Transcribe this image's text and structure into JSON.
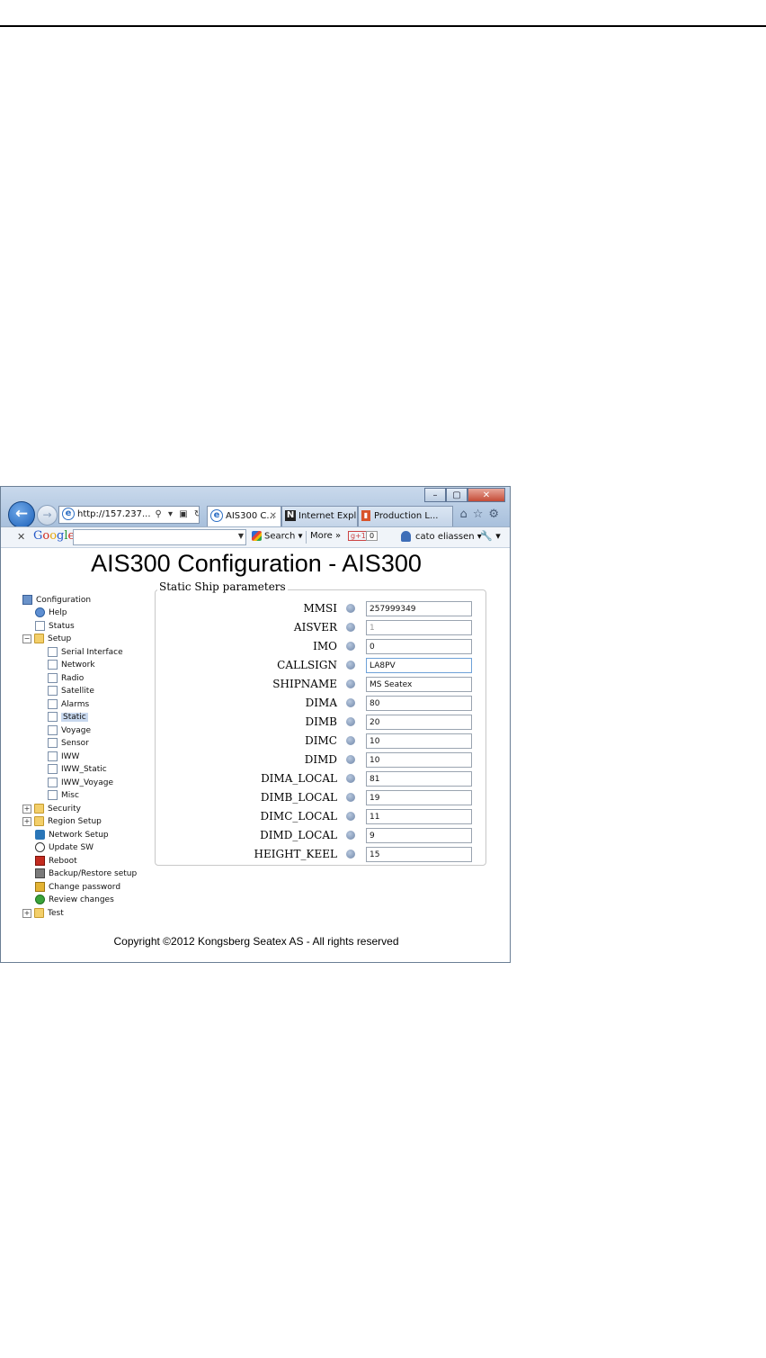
{
  "window": {
    "controls": {
      "minimize": "–",
      "maximize": "▢",
      "close": "✕"
    },
    "address": "http://157.237...",
    "address_controls": "⚲ ▾ ▣ ↻ ✕",
    "tabs": [
      {
        "label": "AIS300 C...",
        "close": "✕"
      },
      {
        "label": "Internet Expl...",
        "icon_text": "N"
      },
      {
        "label": "Production L..."
      }
    ],
    "right_icons": "⌂☆⚙"
  },
  "toolbar": {
    "close": "✕",
    "logo": {
      "G": "G",
      "o1": "o",
      "o2": "o",
      "g": "g",
      "l": "l",
      "e": "e"
    },
    "search_label": "Search ▾",
    "more_label": "More »",
    "plus_label": "g+1",
    "count": "0",
    "user": "cato eliassen ▾",
    "wrench": "🔧 ▾"
  },
  "page": {
    "title": "AIS300 Configuration - AIS300",
    "copyright": "Copyright ©2012 Kongsberg Seatex AS - All rights reserved"
  },
  "tree": {
    "configuration": "Configuration",
    "help": "Help",
    "status": "Status",
    "setup": "Setup",
    "setup_children": [
      "Serial Interface",
      "Network",
      "Radio",
      "Satellite",
      "Alarms",
      "Static",
      "Voyage",
      "Sensor",
      "IWW",
      "IWW_Static",
      "IWW_Voyage",
      "Misc"
    ],
    "security": "Security",
    "region_setup": "Region Setup",
    "network_setup": "Network Setup",
    "update_sw": "Update SW",
    "reboot": "Reboot",
    "backup_restore": "Backup/Restore setup",
    "change_password": "Change password",
    "review_changes": "Review changes",
    "test": "Test",
    "expand_plus": "+",
    "expand_minus": "−"
  },
  "form": {
    "legend": "Static Ship parameters",
    "fields": [
      {
        "label": "MMSI",
        "value": "257999349"
      },
      {
        "label": "AISVER",
        "value": "1"
      },
      {
        "label": "IMO",
        "value": "0"
      },
      {
        "label": "CALLSIGN",
        "value": "LA8PV"
      },
      {
        "label": "SHIPNAME",
        "value": "MS Seatex"
      },
      {
        "label": "DIMA",
        "value": "80"
      },
      {
        "label": "DIMB",
        "value": "20"
      },
      {
        "label": "DIMC",
        "value": "10"
      },
      {
        "label": "DIMD",
        "value": "10"
      },
      {
        "label": "DIMA_LOCAL",
        "value": "81"
      },
      {
        "label": "DIMB_LOCAL",
        "value": "19"
      },
      {
        "label": "DIMC_LOCAL",
        "value": "11"
      },
      {
        "label": "DIMD_LOCAL",
        "value": "9"
      },
      {
        "label": "HEIGHT_KEEL",
        "value": "15"
      }
    ]
  }
}
